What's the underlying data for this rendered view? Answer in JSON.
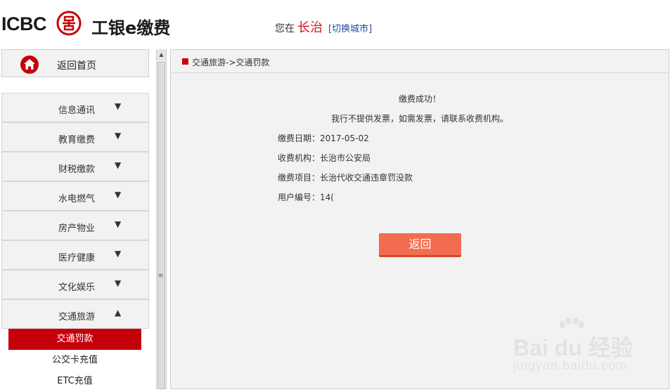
{
  "header": {
    "logo_text": "ICBC",
    "brand_name": "工银e缴费",
    "city_prefix": "您在",
    "city_name": "长治",
    "city_switch": "[切换城市]"
  },
  "sidebar": {
    "home_label": "返回首页",
    "menu": [
      {
        "label": "信息通讯",
        "arrow": "▼"
      },
      {
        "label": "教育缴费",
        "arrow": "▼"
      },
      {
        "label": "财税缴款",
        "arrow": "▼"
      },
      {
        "label": "水电燃气",
        "arrow": "▼"
      },
      {
        "label": "房产物业",
        "arrow": "▼"
      },
      {
        "label": "医疗健康",
        "arrow": "▼"
      },
      {
        "label": "文化娱乐",
        "arrow": "▼"
      },
      {
        "label": "交通旅游",
        "arrow": "▲"
      }
    ],
    "submenu": [
      {
        "label": "交通罚款",
        "active": true
      },
      {
        "label": "公交卡充值",
        "active": false
      },
      {
        "label": "ETC充值",
        "active": false
      }
    ]
  },
  "main": {
    "breadcrumb": "交通旅游->交通罚款",
    "success_msg": "缴费成功！",
    "invoice_msg": "我行不提供发票，如需发票，请联系收费机构。",
    "info": [
      {
        "label": "缴费日期：",
        "value": "2017-05-02"
      },
      {
        "label": "收费机构：",
        "value": "长治市公安局"
      },
      {
        "label": "缴费项目：",
        "value": "长治代收交通违章罚没款"
      },
      {
        "label": "用户编号：",
        "value": "14("
      }
    ],
    "back_label": "返回"
  },
  "watermark": {
    "text": "Bai du 经验",
    "sub": "jingyan.baidu.com"
  },
  "colors": {
    "brand_red": "#c6000b",
    "city_red": "#d8141b",
    "link_blue": "#1f4aa0",
    "button_orange": "#f26d50"
  }
}
